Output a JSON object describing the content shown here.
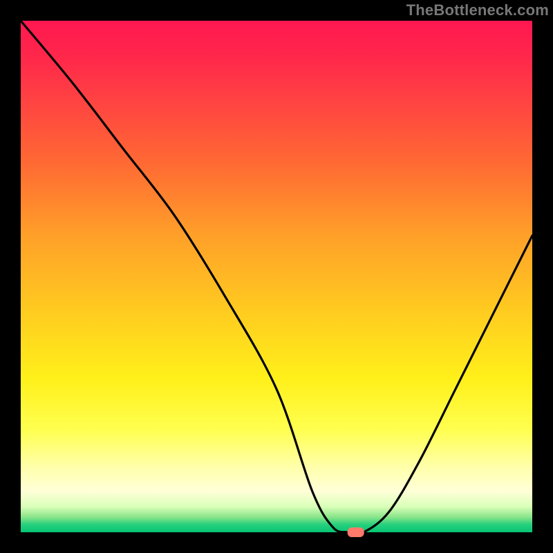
{
  "attribution": "TheBottleneck.com",
  "chart_data": {
    "type": "line",
    "title": "",
    "xlabel": "",
    "ylabel": "",
    "xlim": [
      0,
      100
    ],
    "ylim": [
      0,
      100
    ],
    "grid": false,
    "legend": false,
    "series": [
      {
        "name": "bottleneck-curve",
        "x": [
          0,
          10,
          20,
          30,
          40,
          50,
          57,
          61,
          64,
          67,
          72,
          78,
          85,
          92,
          100
        ],
        "y": [
          100,
          88,
          75,
          62,
          46,
          28,
          8,
          1,
          0,
          0,
          4,
          14,
          28,
          42,
          58
        ]
      }
    ],
    "marker": {
      "x": 65.5,
      "y": 0,
      "color": "#ff7a6a",
      "shape": "pill"
    },
    "gradient_stops": [
      {
        "pos": 0,
        "color": "#ff1750"
      },
      {
        "pos": 0.18,
        "color": "#ff4a3f"
      },
      {
        "pos": 0.42,
        "color": "#ffa029"
      },
      {
        "pos": 0.7,
        "color": "#fff01a"
      },
      {
        "pos": 0.92,
        "color": "#ffffd8"
      },
      {
        "pos": 0.97,
        "color": "#8be58a"
      },
      {
        "pos": 1.0,
        "color": "#06c574"
      }
    ]
  }
}
